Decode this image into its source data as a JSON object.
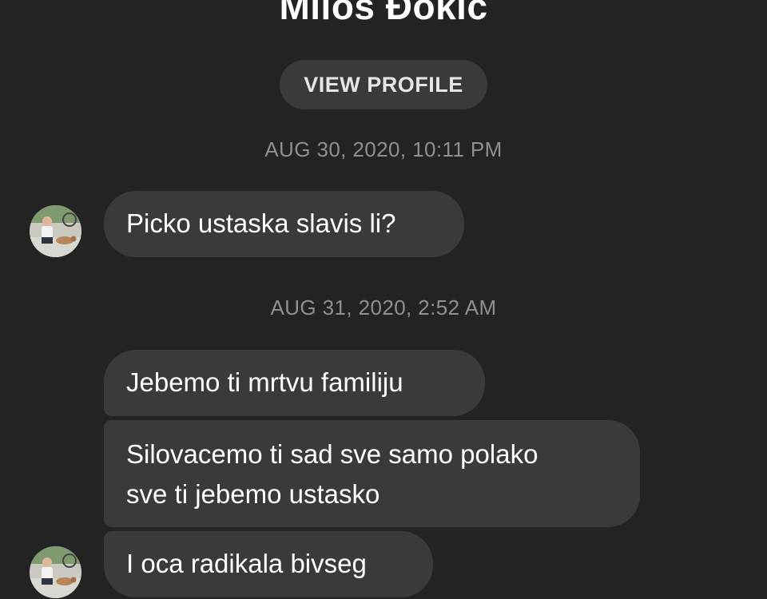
{
  "header": {
    "contact_name": "Miloš Đokić",
    "view_profile_label": "VIEW PROFILE"
  },
  "thread": {
    "groups": [
      {
        "timestamp": "AUG 30, 2020, 10:11 PM",
        "messages": [
          {
            "text": "Picko ustaska slavis li?"
          }
        ]
      },
      {
        "timestamp": "AUG 31, 2020, 2:52 AM",
        "messages": [
          {
            "text": "Jebemo ti mrtvu familiju"
          },
          {
            "line1": "Silovacemo ti sad sve samo polako",
            "line2": "sve ti jebemo ustasko"
          },
          {
            "text": "I oca radikala bivseg"
          }
        ]
      }
    ]
  },
  "colors": {
    "background": "#232323",
    "bubble": "#3a3a3c",
    "timestamp": "#8e8e93",
    "text": "#ffffff"
  }
}
